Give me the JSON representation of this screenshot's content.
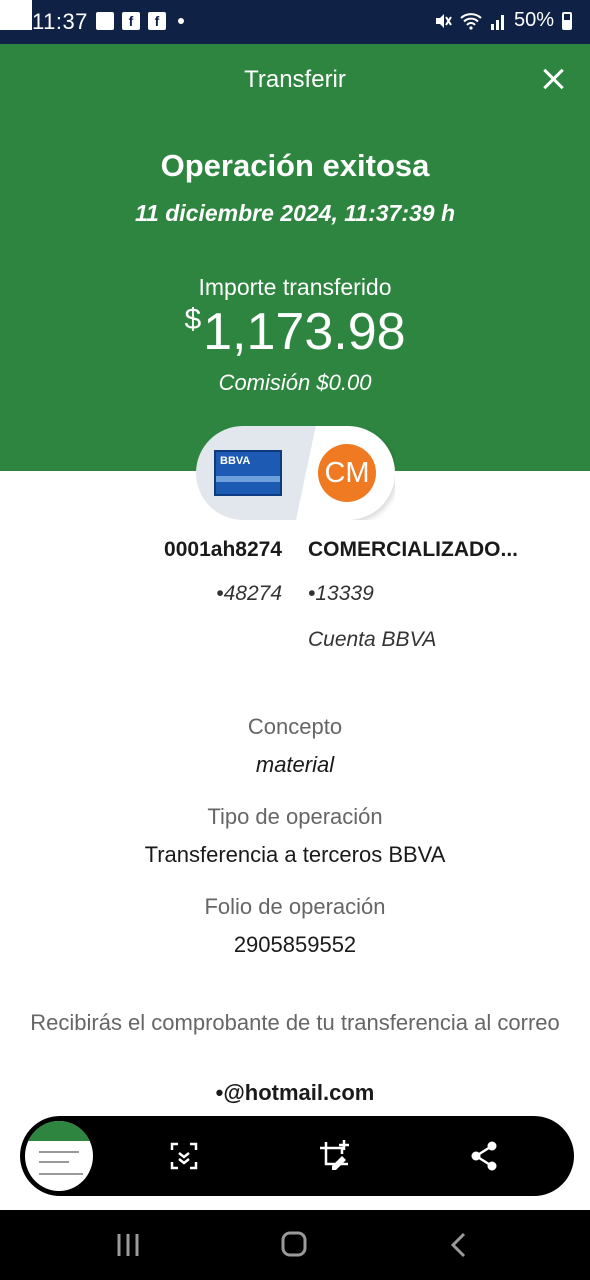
{
  "status_bar": {
    "time": "11:37",
    "battery": "50%",
    "left_icons": [
      "image-icon",
      "facebook-icon",
      "facebook-icon"
    ],
    "right_icons": [
      "mute-icon",
      "wifi-icon",
      "signal-icon",
      "battery-icon"
    ]
  },
  "header": {
    "title": "Transferir",
    "status": "Operación exitosa",
    "date": "11 diciembre 2024, 11:37:39 h",
    "amount_label": "Importe transferido",
    "currency_symbol": "$",
    "amount": "1,173.98",
    "commission": "Comisión  $0.00",
    "background_color": "#2e8540"
  },
  "account_pill": {
    "bank_logo_text": "BBVA",
    "recipient_initials": "CM",
    "avatar_color": "#f07a22"
  },
  "from_account": {
    "name": "0001ah8274",
    "number": "•48274"
  },
  "to_account": {
    "name": "COMERCIALIZADO...",
    "number": "•13339",
    "type": "Cuenta BBVA"
  },
  "details": {
    "concept_label": "Concepto",
    "concept_value": "material",
    "operation_type_label": "Tipo de operación",
    "operation_type_value": "Transferencia a terceros BBVA",
    "folio_label": "Folio de operación",
    "folio_value": "2905859552"
  },
  "receipt": {
    "note": "Recibirás el comprobante de tu transferencia al correo",
    "email": "•@hotmail.com"
  },
  "screenshot_toolbar": {
    "icons": [
      "scroll-capture-icon",
      "crop-edit-icon",
      "share-icon"
    ]
  },
  "nav_bar": {
    "icons": [
      "recents-icon",
      "home-icon",
      "back-icon"
    ]
  }
}
